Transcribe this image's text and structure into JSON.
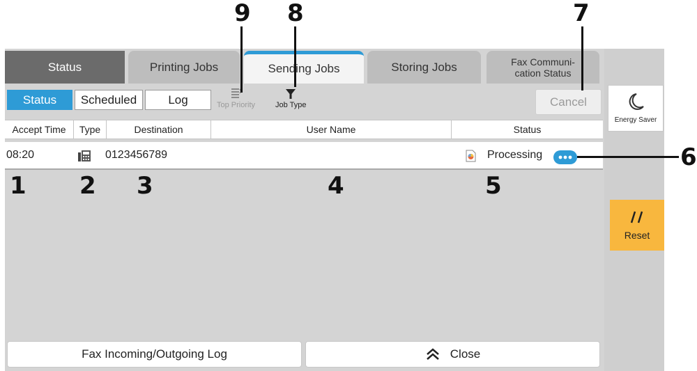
{
  "tabs": [
    {
      "label": "Status"
    },
    {
      "label": "Printing Jobs"
    },
    {
      "label": "Sending Jobs"
    },
    {
      "label": "Storing Jobs"
    },
    {
      "label": "Fax Communi-\ncation Status"
    }
  ],
  "toolbar": {
    "status_label": "Status",
    "scheduled_label": "Scheduled",
    "log_label": "Log",
    "top_priority_label": "Top Priority",
    "job_type_label": "Job Type",
    "cancel_label": "Cancel"
  },
  "table": {
    "headers": [
      "Accept Time",
      "Type",
      "Destination",
      "User Name",
      "Status"
    ],
    "rows": [
      {
        "accept_time": "08:20",
        "type_icon": "fax-icon",
        "destination": "0123456789",
        "user_name": "",
        "status": "Processing"
      }
    ]
  },
  "bottom": {
    "fax_log_label": "Fax Incoming/Outgoing Log",
    "close_label": "Close"
  },
  "side": {
    "energy_saver_label": "Energy Saver",
    "reset_label": "Reset"
  },
  "callouts": [
    "1",
    "2",
    "3",
    "4",
    "5",
    "6",
    "7",
    "8",
    "9"
  ],
  "colors": {
    "accent": "#2e9bd6",
    "reset": "#f8b73e",
    "panel": "#d4d4d4"
  }
}
